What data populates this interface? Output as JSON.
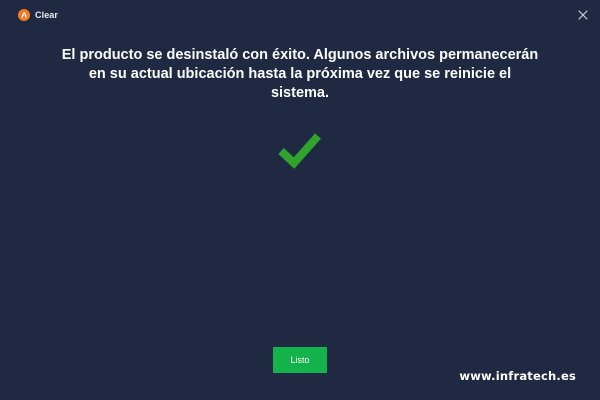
{
  "window": {
    "title": "Clear",
    "app_icon": "avast-logo-icon",
    "close_icon": "close-icon"
  },
  "main": {
    "message": "El producto se desinstaló con éxito. Algunos archivos permanecerán en su actual ubicación hasta la próxima vez que se reinicie el sistema.",
    "status_icon": "checkmark-icon",
    "done_label": "Listo"
  },
  "watermark": "www.infratech.es",
  "colors": {
    "background": "#1f2a42",
    "accent_green": "#13b24a",
    "check_green": "#2fa32b",
    "brand_orange": "#f47a20"
  }
}
